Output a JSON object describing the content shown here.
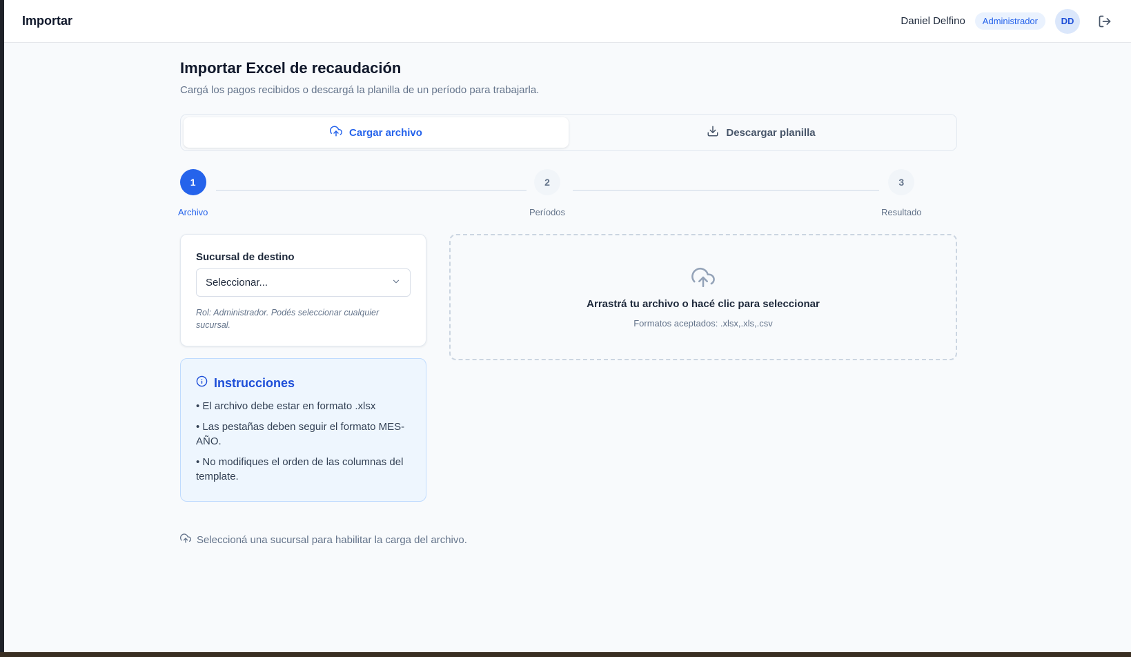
{
  "topbar": {
    "title": "Importar",
    "user_name": "Daniel Delfino",
    "role_badge": "Administrador",
    "avatar_initials": "DD",
    "logout_icon": "logout-icon"
  },
  "page": {
    "title": "Importar Excel de recaudación",
    "subtitle": "Cargá los pagos recibidos o descargá la planilla de un período para trabajarla."
  },
  "tabs": [
    {
      "label": "Cargar archivo",
      "icon": "cloud-upload-icon",
      "active": true
    },
    {
      "label": "Descargar planilla",
      "icon": "download-icon",
      "active": false
    }
  ],
  "stepper": {
    "steps": [
      {
        "number": "1",
        "label": "Archivo",
        "active": true
      },
      {
        "number": "2",
        "label": "Períodos",
        "active": false
      },
      {
        "number": "3",
        "label": "Resultado",
        "active": false
      }
    ]
  },
  "branch": {
    "label": "Sucursal de destino",
    "select_value": "Seleccionar...",
    "hint": "Rol: Administrador. Podés seleccionar cualquier sucursal."
  },
  "instructions": {
    "title": "Instrucciones",
    "items": [
      "• El archivo debe estar en formato .xlsx",
      "• Las pestañas deben seguir el formato MES-AÑO.",
      "• No modifiques el orden de las columnas del template."
    ]
  },
  "dropzone": {
    "title": "Arrastrá tu archivo o hacé clic para seleccionar",
    "formats": "Formatos aceptados: .xlsx,.xls,.csv"
  },
  "notice": "Seleccioná una sucursal para habilitar la carga del archivo.",
  "colors": {
    "accent": "#2563eb",
    "background": "#f8fafc",
    "instructions_bg": "#eef6fe"
  }
}
